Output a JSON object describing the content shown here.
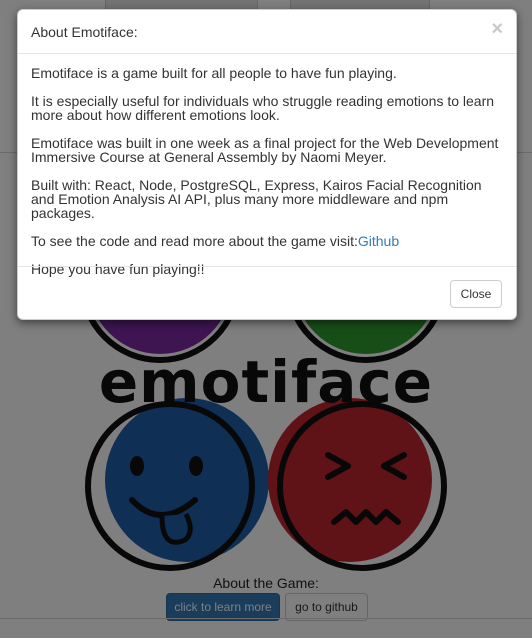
{
  "modal": {
    "title": "About Emotiface:",
    "close_icon": "×",
    "paragraphs": [
      "Emotiface is a game built for all people to have fun playing.",
      "It is especially useful for individuals who struggle reading emotions to learn more about how different emotions look.",
      "Emotiface was built in one week as a final project for the Web Development Immersive Course at General Assembly by Naomi Meyer.",
      "Built with: React, Node, PostgreSQL, Express, Kairos Facial Recognition and Emotion Analysis AI API, plus many more middleware and npm packages.",
      "To see the code and read more about the game visit:",
      "Hope you have fun playing!!"
    ],
    "link_text": "Github",
    "close_button_label": "Close"
  },
  "page": {
    "logo_text": "emotiface",
    "about_label": "About the Game:",
    "learn_button_label": "click to learn more",
    "github_button_label": "go to github"
  },
  "colors": {
    "primary": "#337ab7",
    "purple_face": "#7d2aa3",
    "green_face": "#2e9c2e",
    "blue_face": "#1f5ea8",
    "red_face": "#c0262f",
    "backdrop": "rgba(0,0,0,0.5)"
  },
  "icons": [
    "close-icon",
    "tongue-out-face-icon",
    "grimace-face-icon"
  ]
}
